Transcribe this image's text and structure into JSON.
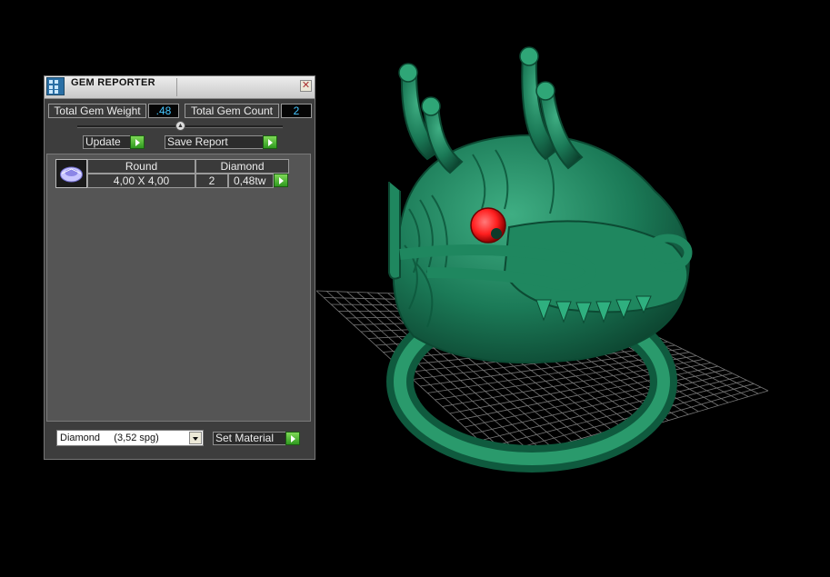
{
  "gem_reporter": {
    "title": "GEM REPORTER",
    "close_glyph": "✕",
    "total_gem_weight_label": "Total Gem Weight",
    "total_gem_weight_value": ".48",
    "total_gem_count_label": "Total Gem Count",
    "total_gem_count_value": "2",
    "update_label": "Update",
    "save_report_label": "Save Report",
    "gems": [
      {
        "shape": "Round",
        "material": "Diamond",
        "size": "4,00 X 4,00",
        "count": "2",
        "weight": "0,48tw"
      }
    ],
    "material_select": {
      "selected": "Diamond     (3,52 spg)"
    },
    "set_material_label": "Set Material"
  },
  "colors": {
    "ring_green": "#1a7a56",
    "gem_red": "#ff1e1e",
    "value_cyan": "#45c6ff",
    "arrow_green": "#4fc032"
  },
  "icons": [
    "app-icon",
    "close-icon",
    "slider-knob-icon",
    "play-arrow-icon",
    "round-gem-icon",
    "dropdown-arrow-icon"
  ]
}
